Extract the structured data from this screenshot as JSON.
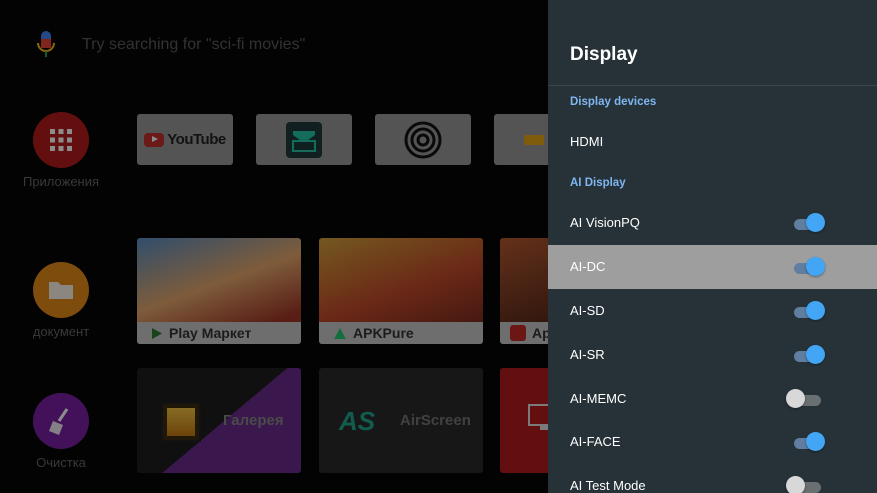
{
  "launcher": {
    "search_placeholder": "Try searching for \"sci-fi movies\"",
    "side_apps": [
      {
        "label": "Приложения",
        "icon": "grid-icon",
        "color": "#b71c1c"
      },
      {
        "label": "документ",
        "icon": "folder-icon",
        "color": "#e58b16"
      },
      {
        "label": "Очистка",
        "icon": "broom-icon",
        "color": "#7b1fa2"
      }
    ],
    "small_tiles": [
      "YouTube"
    ],
    "big_tiles": [
      {
        "label": "Play Маркет"
      },
      {
        "label": "APKPure"
      },
      {
        "label": "Ap"
      }
    ],
    "app_tiles": [
      {
        "label": "Галерея"
      },
      {
        "label": "AirScreen"
      }
    ]
  },
  "panel": {
    "title": "Display",
    "section_devices": "Display devices",
    "hdmi": "HDMI",
    "section_ai": "AI Display",
    "settings": [
      {
        "label": "AI VisionPQ",
        "on": true
      },
      {
        "label": "AI-DC",
        "on": true,
        "focused": true
      },
      {
        "label": "AI-SD",
        "on": true
      },
      {
        "label": "AI-SR",
        "on": true
      },
      {
        "label": "AI-MEMC",
        "on": false
      },
      {
        "label": "AI-FACE",
        "on": true
      },
      {
        "label": "AI Test Mode",
        "on": false
      }
    ]
  },
  "colors": {
    "panel_bg": "#263238",
    "accent_blue": "#42a5f5",
    "section_blue": "#7fb6f0",
    "focus_bg": "#9e9e9e"
  }
}
